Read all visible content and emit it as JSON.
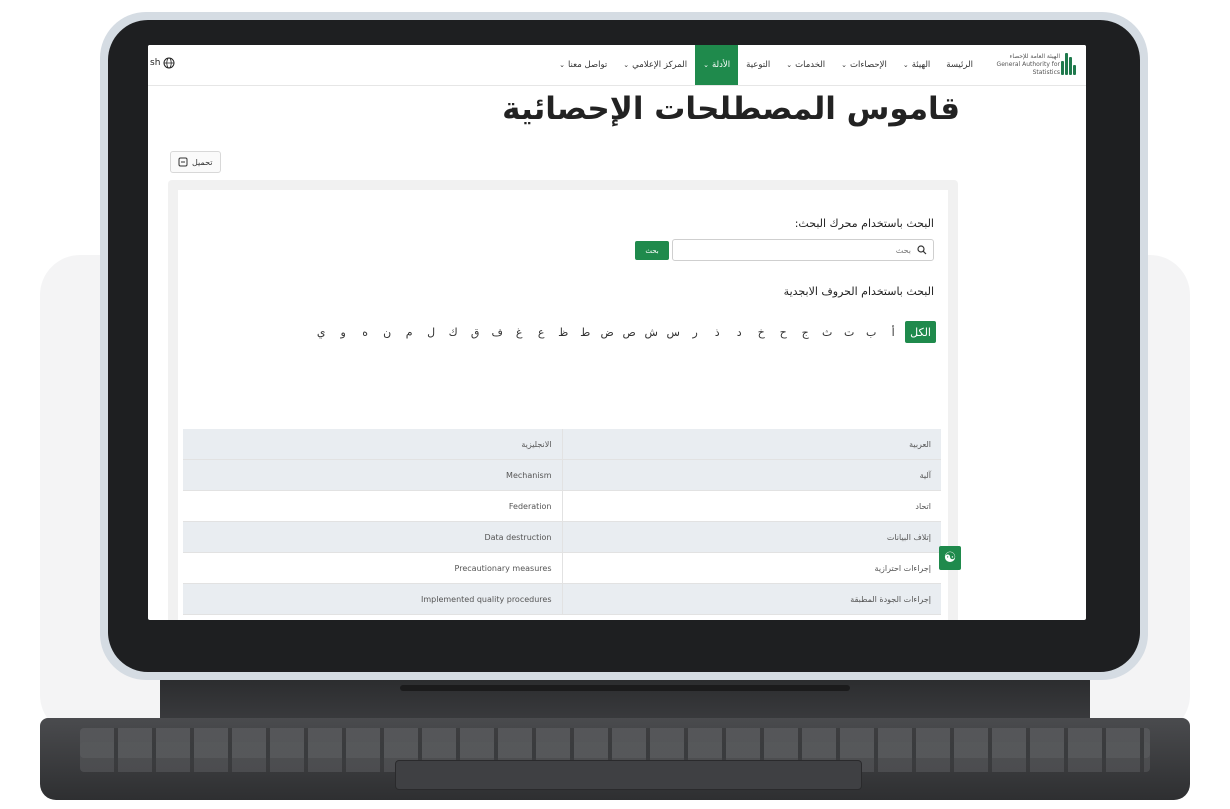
{
  "nav": {
    "items": [
      {
        "label": "الرئيسة",
        "chevron": false,
        "active": false
      },
      {
        "label": "الهيئة",
        "chevron": true,
        "active": false
      },
      {
        "label": "الإحصاءات",
        "chevron": true,
        "active": false
      },
      {
        "label": "الخدمات",
        "chevron": true,
        "active": false
      },
      {
        "label": "التوعية",
        "chevron": false,
        "active": false
      },
      {
        "label": "الأدلة",
        "chevron": true,
        "active": true
      },
      {
        "label": "المركز الإعلامي",
        "chevron": true,
        "active": false
      },
      {
        "label": "تواصل معنا",
        "chevron": true,
        "active": false
      }
    ],
    "language": "English",
    "language_visible": "sh",
    "logo_text_ar": "الهيئة العامة للإحصاء",
    "logo_text_en": "General Authority for Statistics"
  },
  "page": {
    "title": "قاموس المصطلحات الإحصائية",
    "download_label": "تحميل"
  },
  "search": {
    "heading": "البحث باستخدام محرك البحث:",
    "placeholder": "بحث",
    "button_label": "بحث"
  },
  "alphabet": {
    "heading": "البحث باستخدام الحروف الابجدية",
    "letters": [
      "الكل",
      "أ",
      "ب",
      "ت",
      "ث",
      "ج",
      "ح",
      "خ",
      "د",
      "ذ",
      "ر",
      "س",
      "ش",
      "ص",
      "ض",
      "ط",
      "ظ",
      "ع",
      "غ",
      "ف",
      "ق",
      "ك",
      "ل",
      "م",
      "ن",
      "ه",
      "و",
      "ي"
    ],
    "active": "الكل"
  },
  "table": {
    "headers": {
      "arabic": "العربية",
      "english": "الانجليزية"
    },
    "rows": [
      {
        "arabic": "آلية",
        "english": "Mechanism"
      },
      {
        "arabic": "اتحاد",
        "english": "Federation"
      },
      {
        "arabic": "إتلاف البيانات",
        "english": "Data destruction"
      },
      {
        "arabic": "إجراءات احترازية",
        "english": "Precautionary measures"
      },
      {
        "arabic": "إجراءات الجودة المطبقة",
        "english": "Implemented quality procedures"
      }
    ]
  },
  "colors": {
    "accent": "#1f8a4c"
  }
}
